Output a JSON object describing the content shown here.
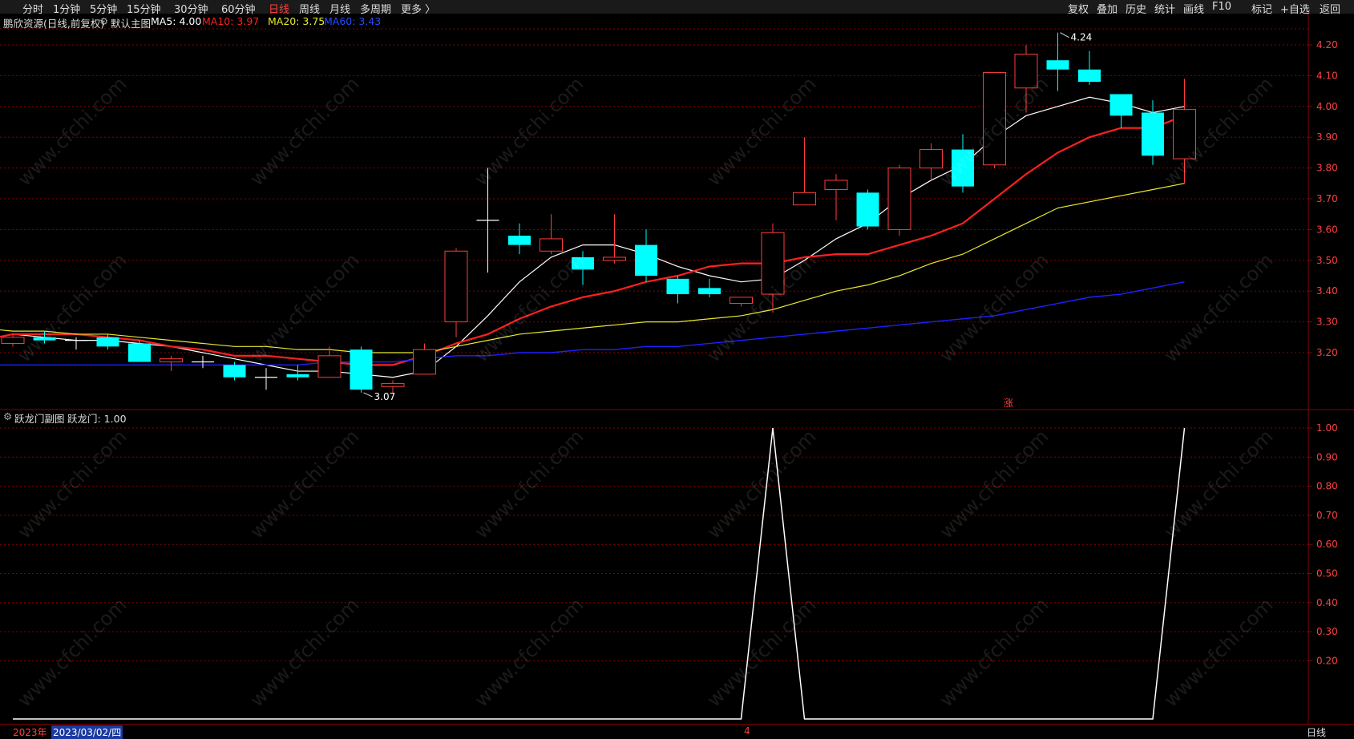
{
  "toolbar": {
    "left_items": [
      "分时",
      "1分钟",
      "5分钟",
      "15分钟",
      "30分钟",
      "60分钟",
      "日线",
      "周线",
      "月线",
      "多周期",
      "更多 〉"
    ],
    "active": "日线",
    "right_items": [
      "复权",
      "叠加",
      "历史",
      "统计",
      "画线",
      "F10",
      "标记",
      "+自选",
      "返回"
    ]
  },
  "main_info": {
    "stock": "鹏欣资源(日线,前复权)",
    "indicator": "默认主图",
    "ma5_label": "MA5: 4.00",
    "ma10_label": "MA10: 3.97",
    "ma20_label": "MA20: 3.75",
    "ma60_label": "MA60: 3.43"
  },
  "sub_info": {
    "indicator": "跃龙门副图",
    "value_label": "跃龙门: 1.00"
  },
  "bottom": {
    "year": "2023年",
    "cursor_date": "2023/03/02/四",
    "month_marker": "4",
    "period": "日线"
  },
  "colors": {
    "up": "#ff3c3c",
    "down": "#00ffff",
    "ma5": "#ffffff",
    "ma10": "#ff2020",
    "ma20": "#e8e830",
    "ma60": "#2020ff",
    "grid": "#8b0000",
    "axis_text": "#ff4040"
  },
  "chart_data": [
    {
      "type": "candlestick",
      "y_ticks": [
        "3.20",
        "3.30",
        "3.40",
        "3.50",
        "3.60",
        "3.70",
        "3.80",
        "3.90",
        "4.00",
        "4.10",
        "4.20"
      ],
      "ylim": [
        3.05,
        4.28
      ],
      "annotations": [
        {
          "text": "4.24",
          "index": 33,
          "value": 4.24
        },
        {
          "text": "3.07",
          "index": 11,
          "value": 3.07
        }
      ],
      "rise_marker": "涨",
      "candles": [
        {
          "o": 3.23,
          "h": 3.26,
          "l": 3.22,
          "c": 3.25
        },
        {
          "o": 3.25,
          "h": 3.27,
          "l": 3.23,
          "c": 3.24
        },
        {
          "o": 3.24,
          "h": 3.25,
          "l": 3.21,
          "c": 3.24
        },
        {
          "o": 3.25,
          "h": 3.26,
          "l": 3.21,
          "c": 3.22
        },
        {
          "o": 3.23,
          "h": 3.24,
          "l": 3.17,
          "c": 3.17
        },
        {
          "o": 3.17,
          "h": 3.19,
          "l": 3.14,
          "c": 3.18
        },
        {
          "o": 3.17,
          "h": 3.19,
          "l": 3.15,
          "c": 3.17
        },
        {
          "o": 3.16,
          "h": 3.17,
          "l": 3.11,
          "c": 3.12
        },
        {
          "o": 3.12,
          "h": 3.15,
          "l": 3.08,
          "c": 3.12
        },
        {
          "o": 3.13,
          "h": 3.16,
          "l": 3.11,
          "c": 3.12
        },
        {
          "o": 3.12,
          "h": 3.22,
          "l": 3.12,
          "c": 3.19
        },
        {
          "o": 3.21,
          "h": 3.22,
          "l": 3.07,
          "c": 3.08
        },
        {
          "o": 3.09,
          "h": 3.11,
          "l": 3.07,
          "c": 3.1
        },
        {
          "o": 3.13,
          "h": 3.23,
          "l": 3.13,
          "c": 3.21
        },
        {
          "o": 3.3,
          "h": 3.54,
          "l": 3.25,
          "c": 3.53
        },
        {
          "o": 3.63,
          "h": 3.8,
          "l": 3.46,
          "c": 3.63
        },
        {
          "o": 3.58,
          "h": 3.62,
          "l": 3.52,
          "c": 3.55
        },
        {
          "o": 3.53,
          "h": 3.65,
          "l": 3.52,
          "c": 3.57
        },
        {
          "o": 3.51,
          "h": 3.53,
          "l": 3.42,
          "c": 3.47
        },
        {
          "o": 3.5,
          "h": 3.65,
          "l": 3.49,
          "c": 3.51
        },
        {
          "o": 3.55,
          "h": 3.6,
          "l": 3.43,
          "c": 3.45
        },
        {
          "o": 3.44,
          "h": 3.45,
          "l": 3.36,
          "c": 3.39
        },
        {
          "o": 3.41,
          "h": 3.44,
          "l": 3.38,
          "c": 3.39
        },
        {
          "o": 3.36,
          "h": 3.38,
          "l": 3.35,
          "c": 3.38
        },
        {
          "o": 3.39,
          "h": 3.62,
          "l": 3.33,
          "c": 3.59
        },
        {
          "o": 3.68,
          "h": 3.9,
          "l": 3.68,
          "c": 3.72
        },
        {
          "o": 3.73,
          "h": 3.78,
          "l": 3.63,
          "c": 3.76
        },
        {
          "o": 3.72,
          "h": 3.73,
          "l": 3.6,
          "c": 3.61
        },
        {
          "o": 3.6,
          "h": 3.81,
          "l": 3.58,
          "c": 3.8
        },
        {
          "o": 3.8,
          "h": 3.88,
          "l": 3.76,
          "c": 3.86
        },
        {
          "o": 3.86,
          "h": 3.91,
          "l": 3.72,
          "c": 3.74
        },
        {
          "o": 3.81,
          "h": 4.11,
          "l": 3.8,
          "c": 4.11
        },
        {
          "o": 4.06,
          "h": 4.2,
          "l": 3.98,
          "c": 4.17
        },
        {
          "o": 4.15,
          "h": 4.24,
          "l": 4.05,
          "c": 4.12
        },
        {
          "o": 4.12,
          "h": 4.18,
          "l": 4.07,
          "c": 4.08
        },
        {
          "o": 4.04,
          "h": 4.04,
          "l": 3.93,
          "c": 3.97
        },
        {
          "o": 3.98,
          "h": 4.02,
          "l": 3.81,
          "c": 3.84
        },
        {
          "o": 3.83,
          "h": 4.09,
          "l": 3.75,
          "c": 3.99
        }
      ],
      "series": [
        {
          "name": "MA5",
          "values": [
            3.26,
            3.25,
            3.24,
            3.24,
            3.23,
            3.22,
            3.2,
            3.18,
            3.16,
            3.14,
            3.14,
            3.13,
            3.12,
            3.14,
            3.22,
            3.32,
            3.43,
            3.51,
            3.55,
            3.55,
            3.52,
            3.48,
            3.45,
            3.43,
            3.44,
            3.5,
            3.57,
            3.62,
            3.7,
            3.76,
            3.81,
            3.9,
            3.97,
            4.0,
            4.03,
            4.01,
            3.98,
            4.0
          ]
        },
        {
          "name": "MA10",
          "values": [
            3.24,
            3.26,
            3.26,
            3.26,
            3.25,
            3.24,
            3.22,
            3.21,
            3.19,
            3.19,
            3.18,
            3.17,
            3.16,
            3.16,
            3.19,
            3.23,
            3.26,
            3.31,
            3.35,
            3.38,
            3.4,
            3.43,
            3.45,
            3.48,
            3.49,
            3.49,
            3.51,
            3.52,
            3.52,
            3.55,
            3.58,
            3.62,
            3.7,
            3.78,
            3.85,
            3.9,
            3.93,
            3.93,
            3.97
          ]
        },
        {
          "name": "MA20",
          "values": [
            3.28,
            3.27,
            3.27,
            3.26,
            3.26,
            3.25,
            3.24,
            3.23,
            3.22,
            3.22,
            3.21,
            3.21,
            3.2,
            3.2,
            3.2,
            3.22,
            3.24,
            3.26,
            3.27,
            3.28,
            3.29,
            3.3,
            3.3,
            3.31,
            3.32,
            3.34,
            3.37,
            3.4,
            3.42,
            3.45,
            3.49,
            3.52,
            3.57,
            3.62,
            3.67,
            3.69,
            3.71,
            3.73,
            3.75
          ]
        },
        {
          "name": "MA60",
          "values": [
            3.16,
            3.16,
            3.16,
            3.16,
            3.16,
            3.16,
            3.16,
            3.16,
            3.16,
            3.16,
            3.16,
            3.17,
            3.17,
            3.17,
            3.18,
            3.19,
            3.19,
            3.2,
            3.2,
            3.21,
            3.21,
            3.22,
            3.22,
            3.23,
            3.24,
            3.25,
            3.26,
            3.27,
            3.28,
            3.29,
            3.3,
            3.31,
            3.32,
            3.34,
            3.36,
            3.38,
            3.39,
            3.41,
            3.43
          ]
        }
      ]
    },
    {
      "type": "line",
      "name": "跃龙门",
      "y_ticks": [
        "0.20",
        "0.30",
        "0.40",
        "0.50",
        "0.60",
        "0.70",
        "0.80",
        "0.90",
        "1.00"
      ],
      "ylim": [
        0,
        1.0
      ],
      "values": [
        0,
        0,
        0,
        0,
        0,
        0,
        0,
        0,
        0,
        0,
        0,
        0,
        0,
        0,
        0,
        0,
        0,
        0,
        0,
        0,
        0,
        0,
        0,
        0,
        1,
        0,
        0,
        0,
        0,
        0,
        0,
        0,
        0,
        0,
        0,
        0,
        0,
        1
      ]
    }
  ]
}
